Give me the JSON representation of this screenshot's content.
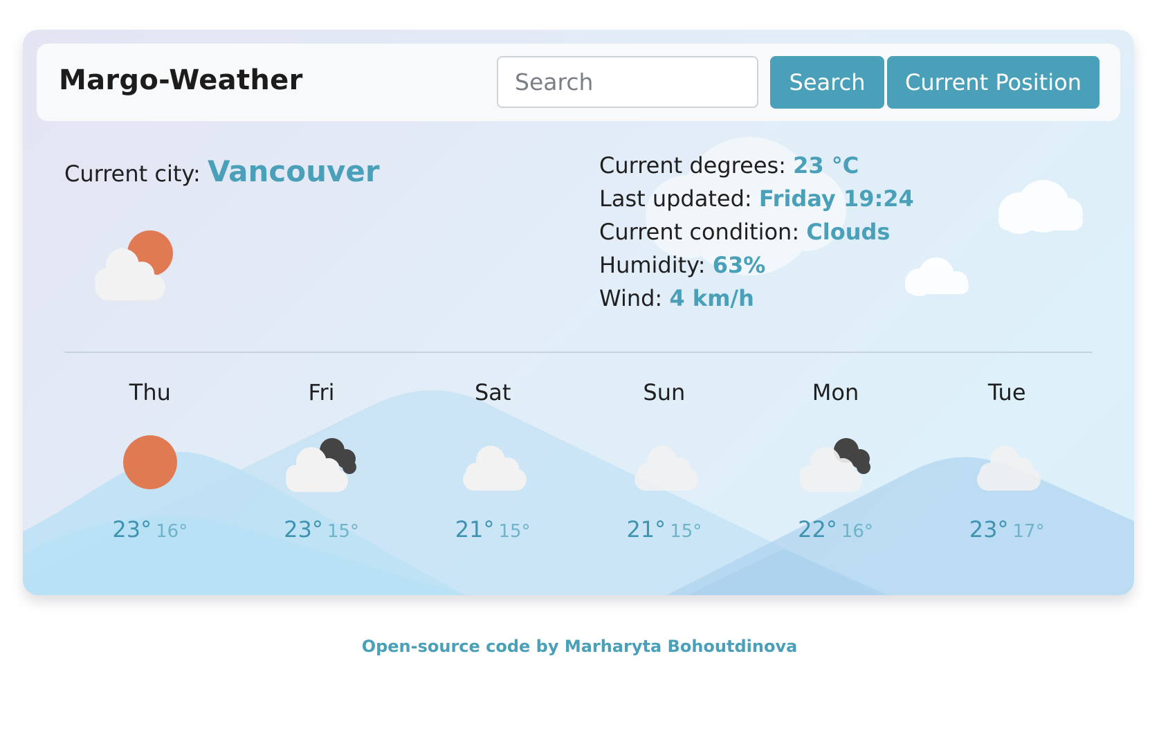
{
  "brand": "Margo-Weather",
  "search": {
    "placeholder": "Search",
    "value": "",
    "search_button": "Search",
    "position_button": "Current Position"
  },
  "current": {
    "city_label": "Current city:",
    "city": "Vancouver",
    "icon": "cloud-sun-icon",
    "degrees_label": "Current degrees:",
    "degrees": "23 °C",
    "updated_label": "Last updated:",
    "updated": "Friday 19:24",
    "condition_label": "Current condition:",
    "condition": "Clouds",
    "humidity_label": "Humidity:",
    "humidity": "63%",
    "wind_label": "Wind:",
    "wind": "4 km/h"
  },
  "forecast": [
    {
      "day": "Thu",
      "icon": "sun-icon",
      "max": "23°",
      "min": "16°"
    },
    {
      "day": "Fri",
      "icon": "cloud-dark-cloud-icon",
      "max": "23°",
      "min": "15°"
    },
    {
      "day": "Sat",
      "icon": "cloud-icon",
      "max": "21°",
      "min": "15°"
    },
    {
      "day": "Sun",
      "icon": "cloud-icon",
      "max": "21°",
      "min": "15°"
    },
    {
      "day": "Mon",
      "icon": "cloud-dark-cloud-icon",
      "max": "22°",
      "min": "16°"
    },
    {
      "day": "Tue",
      "icon": "cloud-icon",
      "max": "23°",
      "min": "17°"
    }
  ],
  "footer": "Open-source code by Marharyta Bohoutdinova",
  "colors": {
    "accent": "#4aa0b8",
    "sun": "#e07a52",
    "cloud": "#f2f2f2",
    "dark_cloud": "#444444"
  }
}
